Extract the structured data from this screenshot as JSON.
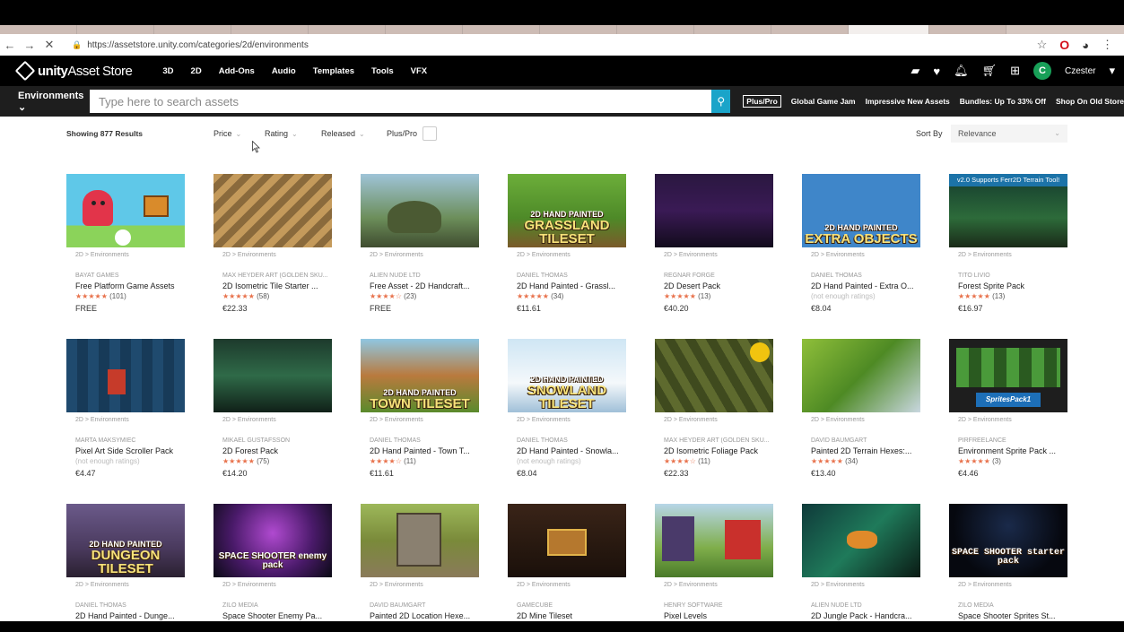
{
  "browser": {
    "url": "https://assetstore.unity.com/categories/2d/environments",
    "opera_label": "O"
  },
  "nav": {
    "logo_text": "unity",
    "logo_suffix": "Asset Store",
    "categories": [
      "3D",
      "2D",
      "Add-Ons",
      "Audio",
      "Templates",
      "Tools",
      "VFX"
    ],
    "user_initial": "C",
    "user_name": "Czester"
  },
  "searchbar": {
    "category": "Environments",
    "placeholder": "Type here to search assets",
    "promos": [
      "Plus/Pro",
      "Global Game Jam",
      "Impressive New Assets",
      "Bundles: Up To 33% Off",
      "Shop On Old Store"
    ]
  },
  "filters": {
    "results": "Showing 877 Results",
    "price": "Price",
    "rating": "Rating",
    "released": "Released",
    "pluspro": "Plus/Pro",
    "sort_label": "Sort By",
    "sort_value": "Relevance"
  },
  "assets": [
    {
      "crumb": "2D > Environments",
      "publisher": "BAYAT GAMES",
      "name": "Free Platform Game Assets",
      "stars": "★★★★★",
      "count": "(101)",
      "price": "FREE"
    },
    {
      "crumb": "2D > Environments",
      "publisher": "MAX HEYDER ART (GOLDEN SKU...",
      "name": "2D Isometric Tile Starter ...",
      "stars": "★★★★★",
      "count": "(58)",
      "price": "€22.33"
    },
    {
      "crumb": "2D > Environments",
      "publisher": "ALIEN NUDE LTD",
      "name": "Free Asset - 2D Handcraft...",
      "stars": "★★★★☆",
      "count": "(23)",
      "price": "FREE"
    },
    {
      "crumb": "2D > Environments",
      "publisher": "DANIEL THOMAS",
      "name": "2D Hand Painted - Grassl...",
      "stars": "★★★★★",
      "count": "(34)",
      "price": "€11.61",
      "thumb_small": "2D HAND PAINTED",
      "thumb_large": "GRASSLAND TILESET"
    },
    {
      "crumb": "2D > Environments",
      "publisher": "REGNAR FORGE",
      "name": "2D Desert Pack",
      "stars": "★★★★★",
      "count": "(13)",
      "price": "€40.20"
    },
    {
      "crumb": "2D > Environments",
      "publisher": "DANIEL THOMAS",
      "name": "2D Hand Painted - Extra O...",
      "stars": "",
      "count": "(not enough ratings)",
      "price": "€8.04",
      "thumb_small": "2D HAND PAINTED",
      "thumb_large": "EXTRA OBJECTS"
    },
    {
      "crumb": "2D > Environments",
      "publisher": "TITO LIVIO",
      "name": "Forest Sprite Pack",
      "stars": "★★★★★",
      "count": "(13)",
      "price": "€16.97",
      "thumb_banner": "v2.0 Supports Ferr2D Terrain Tool!"
    },
    {
      "crumb": "2D > Environments",
      "publisher": "MARTA MAKSYMIEC",
      "name": "Pixel Art Side Scroller Pack",
      "stars": "",
      "count": "(not enough ratings)",
      "price": "€4.47"
    },
    {
      "crumb": "2D > Environments",
      "publisher": "MIKAEL GUSTAFSSON",
      "name": "2D Forest Pack",
      "stars": "★★★★★",
      "count": "(75)",
      "price": "€14.20"
    },
    {
      "crumb": "2D > Environments",
      "publisher": "DANIEL THOMAS",
      "name": "2D Hand Painted - Town T...",
      "stars": "★★★★☆",
      "count": "(11)",
      "price": "€11.61",
      "thumb_small": "2D HAND PAINTED",
      "thumb_large": "TOWN TILESET"
    },
    {
      "crumb": "2D > Environments",
      "publisher": "DANIEL THOMAS",
      "name": "2D Hand Painted - Snowla...",
      "stars": "",
      "count": "(not enough ratings)",
      "price": "€8.04",
      "thumb_small": "2D HAND PAINTED",
      "thumb_large": "SNOWLAND TILESET"
    },
    {
      "crumb": "2D > Environments",
      "publisher": "MAX HEYDER ART (GOLDEN SKU...",
      "name": "2D Isometric Foliage Pack",
      "stars": "★★★★☆",
      "count": "(11)",
      "price": "€22.33"
    },
    {
      "crumb": "2D > Environments",
      "publisher": "DAVID BAUMGART",
      "name": "Painted 2D Terrain Hexes:...",
      "stars": "★★★★★",
      "count": "(34)",
      "price": "€13.40"
    },
    {
      "crumb": "2D > Environments",
      "publisher": "PIRFREELANCE",
      "name": "Environment Sprite Pack ...",
      "stars": "★★★★★",
      "count": "(3)",
      "price": "€4.46",
      "thumb_banner": "SpritesPack1"
    },
    {
      "crumb": "2D > Environments",
      "publisher": "DANIEL THOMAS",
      "name": "2D Hand Painted - Dunge...",
      "stars": "",
      "count": "",
      "price": "",
      "thumb_small": "2D HAND PAINTED",
      "thumb_large": "DUNGEON TILESET"
    },
    {
      "crumb": "2D > Environments",
      "publisher": "ZILO MEDIA",
      "name": "Space Shooter Enemy Pa...",
      "stars": "",
      "count": "",
      "price": "",
      "thumb_small": "",
      "thumb_large": "SPACE SHOOTER enemy pack"
    },
    {
      "crumb": "2D > Environments",
      "publisher": "DAVID BAUMGART",
      "name": "Painted 2D Location Hexe...",
      "stars": "",
      "count": "",
      "price": ""
    },
    {
      "crumb": "2D > Environments",
      "publisher": "GAMECUBE",
      "name": "2D Mine Tileset",
      "stars": "",
      "count": "",
      "price": ""
    },
    {
      "crumb": "2D > Environments",
      "publisher": "HENRY SOFTWARE",
      "name": "Pixel Levels",
      "stars": "",
      "count": "",
      "price": ""
    },
    {
      "crumb": "2D > Environments",
      "publisher": "ALIEN NUDE LTD",
      "name": "2D Jungle Pack - Handcra...",
      "stars": "",
      "count": "",
      "price": ""
    },
    {
      "crumb": "2D > Environments",
      "publisher": "ZILO MEDIA",
      "name": "Space Shooter Sprites St...",
      "stars": "",
      "count": "",
      "price": "",
      "thumb_small": "",
      "thumb_large": "SPACE SHOOTER starter pack"
    }
  ]
}
